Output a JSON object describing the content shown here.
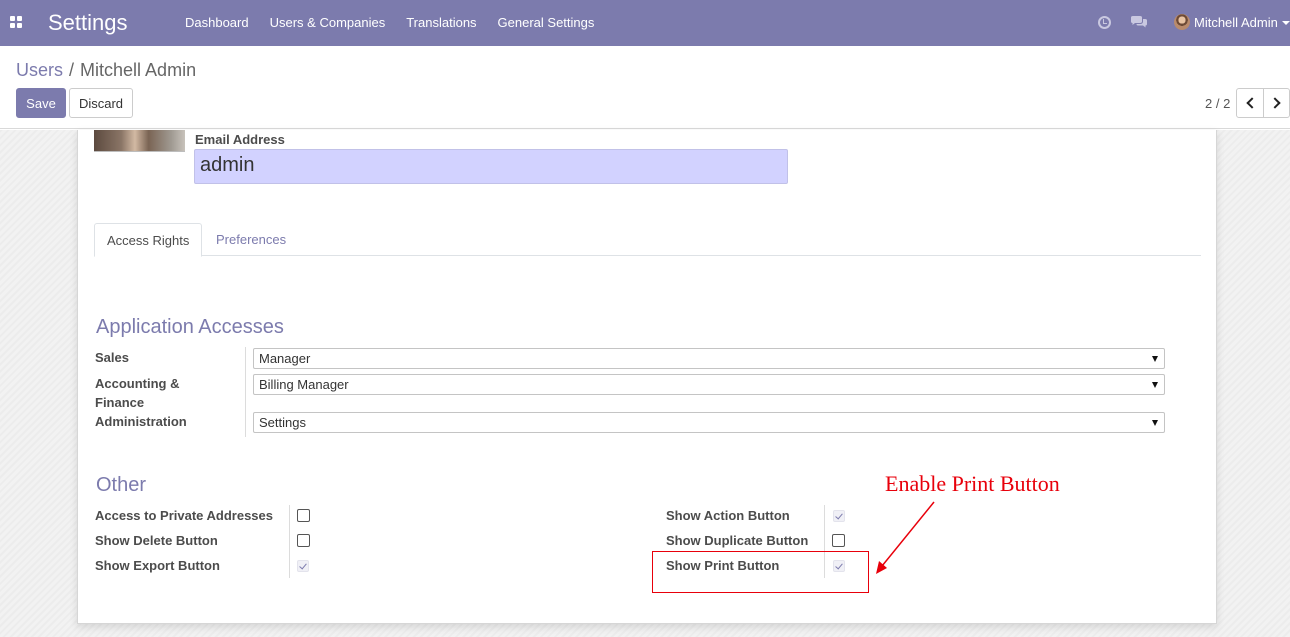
{
  "navbar": {
    "app_title": "Settings",
    "menu": [
      "Dashboard",
      "Users & Companies",
      "Translations",
      "General Settings"
    ],
    "user_name": "Mitchell Admin",
    "background": "#7c7bad"
  },
  "breadcrumb": {
    "parent": "Users",
    "separator": "/",
    "current": "Mitchell Admin"
  },
  "buttons": {
    "save": "Save",
    "discard": "Discard"
  },
  "pager": {
    "value": "2 / 2"
  },
  "form": {
    "email_label": "Email Address",
    "email_value": "admin",
    "tabs": [
      "Access Rights",
      "Preferences"
    ],
    "active_tab": "Access Rights"
  },
  "application_accesses": {
    "title": "Application Accesses",
    "fields": [
      {
        "label": "Sales",
        "value": "Manager"
      },
      {
        "label": "Accounting & Finance",
        "value": "Billing Manager"
      },
      {
        "label": "Administration",
        "value": "Settings"
      }
    ]
  },
  "other": {
    "title": "Other",
    "left": [
      {
        "label": "Access to Private Addresses",
        "checked": false
      },
      {
        "label": "Show Delete Button",
        "checked": false
      },
      {
        "label": "Show Export Button",
        "checked": true
      }
    ],
    "right": [
      {
        "label": "Show Action Button",
        "checked": true
      },
      {
        "label": "Show Duplicate Button",
        "checked": false
      },
      {
        "label": "Show Print Button",
        "checked": true
      }
    ]
  },
  "annotation": {
    "text": "Enable Print Button",
    "color": "#e8000b"
  },
  "icons": [
    "apps-icon",
    "clock-icon",
    "chat-icon",
    "chevron-left-icon",
    "chevron-right-icon"
  ]
}
